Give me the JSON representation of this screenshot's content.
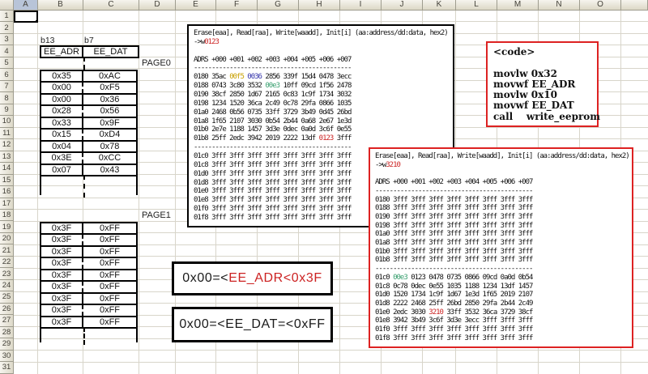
{
  "window": {
    "type": "excel-worksheet",
    "selected_cell": "A1"
  },
  "colors": {
    "accent_red": "#cc2222",
    "hex_gold": "#c8a000",
    "hex_blue": "#3333aa",
    "hex_green": "#3aa070",
    "box_red_border": "#dd2222",
    "gridline": "#d8d5ca",
    "header_border": "#9e9c8e",
    "selected_header": "#b8c4d8"
  },
  "grid": {
    "row_count": 31,
    "columns": [
      {
        "label": "A",
        "width": 30,
        "selected": true
      },
      {
        "label": "B",
        "width": 56
      },
      {
        "label": "C",
        "width": 69
      },
      {
        "label": "D",
        "width": 45
      },
      {
        "label": "E",
        "width": 50
      },
      {
        "label": "F",
        "width": 51
      },
      {
        "label": "G",
        "width": 51
      },
      {
        "label": "H",
        "width": 51
      },
      {
        "label": "I",
        "width": 51
      },
      {
        "label": "J",
        "width": 51
      },
      {
        "label": "K",
        "width": 41
      },
      {
        "label": "L",
        "width": 51
      },
      {
        "label": "M",
        "width": 51
      },
      {
        "label": "N",
        "width": 51
      },
      {
        "label": "O",
        "width": 51
      },
      {
        "label": "",
        "width": 33
      }
    ]
  },
  "cells": {
    "b13_label": "b13",
    "b7_label": "b7",
    "page0_label": "PAGE0",
    "page1_label": "PAGE1"
  },
  "ee_table": {
    "col1_header": "EE_ADR",
    "col2_header": "EE_DAT",
    "page0_rows": [
      [
        "0x35",
        "0xAC"
      ],
      [
        "0x00",
        "0xF5"
      ],
      [
        "0x00",
        "0x36"
      ],
      [
        "0x28",
        "0x56"
      ],
      [
        "0x33",
        "0x9F"
      ],
      [
        "0x15",
        "0xD4"
      ],
      [
        "0x04",
        "0x78"
      ],
      [
        "0x3E",
        "0xCC"
      ],
      [
        "0x07",
        "0x43"
      ]
    ],
    "page1_rows": [
      [
        "0x3F",
        "0xFF"
      ],
      [
        "0x3F",
        "0xFF"
      ],
      [
        "0x3F",
        "0xFF"
      ],
      [
        "0x3F",
        "0xFF"
      ],
      [
        "0x3F",
        "0xFF"
      ],
      [
        "0x3F",
        "0xFF"
      ],
      [
        "0x3F",
        "0xFF"
      ],
      [
        "0x3F",
        "0xFF"
      ],
      [
        "0x3F",
        "0xFF"
      ]
    ]
  },
  "constraint_boxes": {
    "adr_prefix": "0x00=<",
    "adr_highlight": "EE_ADR<0x3F",
    "dat_text": "0x00=<EE_DAT=<0xFF"
  },
  "code_box": {
    "lines": [
      "<code>",
      "",
      "movlw 0x32",
      "movwf EE_ADR",
      "movlw 0x10",
      "movwf EE_DAT",
      "call    write_eeprom"
    ]
  },
  "terminal_top": {
    "lines": [
      [
        [
          "Erase[eaa], Read[raa], Write[waadd], Init[i] (aa:address/dd:data, hex2)"
        ]
      ],
      [
        [
          "->w"
        ],
        [
          "0123",
          "red"
        ]
      ],
      [],
      [
        [
          "ADRS +000 +001 +002 +003 +004 +005 +006 +007"
        ]
      ],
      [
        [
          "--------------------------------------------"
        ]
      ],
      [
        [
          "0180 35ac "
        ],
        [
          "00f5",
          "gold"
        ],
        [
          " "
        ],
        [
          "0036",
          "blue"
        ],
        [
          " 2856 339f 15d4 0478 3ecc"
        ]
      ],
      [
        [
          "0188 0743 3c80 3532 "
        ],
        [
          "00e3",
          "green"
        ],
        [
          " 10ff 09cd 1f56 2478"
        ]
      ],
      [
        [
          "0190 38cf 2850 1d67 2165 0c83 1c9f 1734 3032"
        ]
      ],
      [
        [
          "0198 1234 1520 36ca 2c49 0c78 29fa 0866 1035"
        ]
      ],
      [
        [
          "01a0 2468 0b56 0735 33ff 3729 3b49 0d45 26bd"
        ]
      ],
      [
        [
          "01a8 1f65 2107 3030 0b54 2b44 0a68 2e67 1e3d"
        ]
      ],
      [
        [
          "01b0 2e7e 1188 1457 3d3e 0dec 0a0d 3c6f 0e55"
        ]
      ],
      [
        [
          "01b8 25ff 2edc 3942 2019 2222 13df "
        ],
        [
          "0123",
          "red"
        ],
        [
          " 3fff"
        ]
      ],
      [
        [
          "--------------------------------------------"
        ]
      ],
      [
        [
          "01c0 3fff 3fff 3fff 3fff 3fff 3fff 3fff 3fff"
        ]
      ],
      [
        [
          "01c8 3fff 3fff 3fff 3fff 3fff 3fff 3fff 3fff"
        ]
      ],
      [
        [
          "01d0 3fff 3fff 3fff 3fff 3fff 3fff 3fff 3fff"
        ]
      ],
      [
        [
          "01d8 3fff 3fff 3fff 3fff 3fff 3fff 3fff 3fff"
        ]
      ],
      [
        [
          "01e0 3fff 3fff 3fff 3fff 3fff 3fff 3fff 3fff"
        ]
      ],
      [
        [
          "01e8 3fff 3fff 3fff 3fff 3fff 3fff 3fff 3fff"
        ]
      ],
      [
        [
          "01f0 3fff 3fff 3fff 3fff 3fff 3fff 3fff 3fff"
        ]
      ],
      [
        [
          "01f8 3fff 3fff 3fff 3fff 3fff 3fff 3fff 3fff"
        ]
      ]
    ]
  },
  "terminal_right": {
    "lines": [
      [
        [
          "Erase[eaa], Read[raa], Write[waadd], Init[i] (aa:address/dd:data, hex2)"
        ]
      ],
      [
        [
          "->w"
        ],
        [
          "3210",
          "red"
        ]
      ],
      [],
      [
        [
          "ADRS +000 +001 +002 +003 +004 +005 +006 +007"
        ]
      ],
      [
        [
          "--------------------------------------------"
        ]
      ],
      [
        [
          "0180 3fff 3fff 3fff 3fff 3fff 3fff 3fff 3fff"
        ]
      ],
      [
        [
          "0188 3fff 3fff 3fff 3fff 3fff 3fff 3fff 3fff"
        ]
      ],
      [
        [
          "0190 3fff 3fff 3fff 3fff 3fff 3fff 3fff 3fff"
        ]
      ],
      [
        [
          "0198 3fff 3fff 3fff 3fff 3fff 3fff 3fff 3fff"
        ]
      ],
      [
        [
          "01a0 3fff 3fff 3fff 3fff 3fff 3fff 3fff 3fff"
        ]
      ],
      [
        [
          "01a8 3fff 3fff 3fff 3fff 3fff 3fff 3fff 3fff"
        ]
      ],
      [
        [
          "01b0 3fff 3fff 3fff 3fff 3fff 3fff 3fff 3fff"
        ]
      ],
      [
        [
          "01b8 3fff 3fff 3fff 3fff 3fff 3fff 3fff 3fff"
        ]
      ],
      [
        [
          "--------------------------------------------"
        ]
      ],
      [
        [
          "01c0 "
        ],
        [
          "00e3",
          "green"
        ],
        [
          " 0123 0478 0735 0866 09cd 0a0d 0b54"
        ]
      ],
      [
        [
          "01c8 0c78 0dec 0e55 1035 1188 1234 13df 1457"
        ]
      ],
      [
        [
          "01d0 1520 1734 1c9f 1d67 1e3d 1f65 2019 2107"
        ]
      ],
      [
        [
          "01d8 2222 2468 25ff 26bd 2850 29fa 2b44 2c49"
        ]
      ],
      [
        [
          "01e0 2edc 3030 "
        ],
        [
          "3210",
          "red"
        ],
        [
          " 33ff 3532 36ca 3729 38cf"
        ]
      ],
      [
        [
          "01e8 3942 3b49 3c6f 3d3e 3ecc 3fff 3fff 3fff"
        ]
      ],
      [
        [
          "01f0 3fff 3fff 3fff 3fff 3fff 3fff 3fff 3fff"
        ]
      ],
      [
        [
          "01f8 3fff 3fff 3fff 3fff 3fff 3fff 3fff 3fff"
        ]
      ]
    ]
  }
}
